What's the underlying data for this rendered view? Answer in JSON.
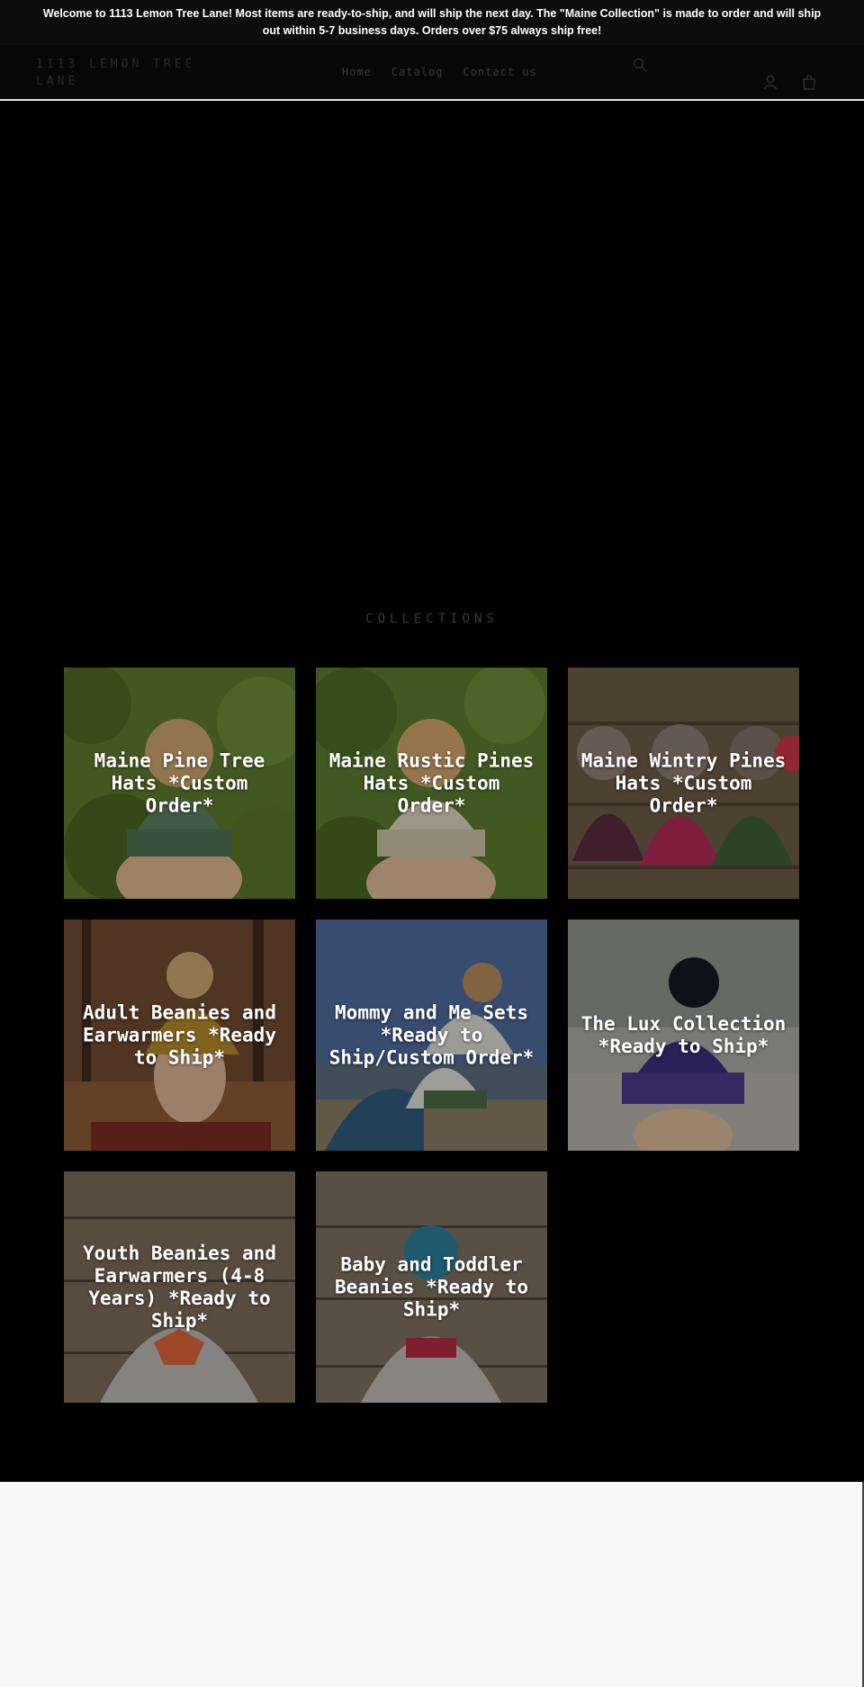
{
  "announcement": {
    "text": "Welcome to 1113 Lemon Tree Lane! Most items are ready-to-ship, and will ship the next day. The \"Maine Collection\" is made to order and will ship out within 5-7 business days. Orders over $75 always ship free!"
  },
  "header": {
    "logo": "1113 LEMON TREE LANE",
    "nav": [
      "Home",
      "Catalog",
      "Contact us"
    ],
    "icons": [
      "search-icon",
      "account-icon",
      "cart-icon"
    ]
  },
  "collections": {
    "title": "COLLECTIONS",
    "items": [
      {
        "title": "Maine Pine Tree Hats *Custom Order*"
      },
      {
        "title": "Maine Rustic Pines Hats *Custom Order*"
      },
      {
        "title": "Maine Wintry Pines Hats *Custom Order*"
      },
      {
        "title": "Adult Beanies and Earwarmers *Ready to Ship*"
      },
      {
        "title": "Mommy and Me Sets *Ready to Ship/Custom Order*"
      },
      {
        "title": "The Lux Collection *Ready to Ship*"
      },
      {
        "title": "Youth Beanies and Earwarmers (4-8 Years) *Ready to Ship*"
      },
      {
        "title": "Baby and Toddler Beanies *Ready to Ship*"
      }
    ]
  },
  "colors": {
    "background": "#000000",
    "announcement_bg": "#0d0d0d",
    "footer_bg": "#f7f7f7"
  }
}
